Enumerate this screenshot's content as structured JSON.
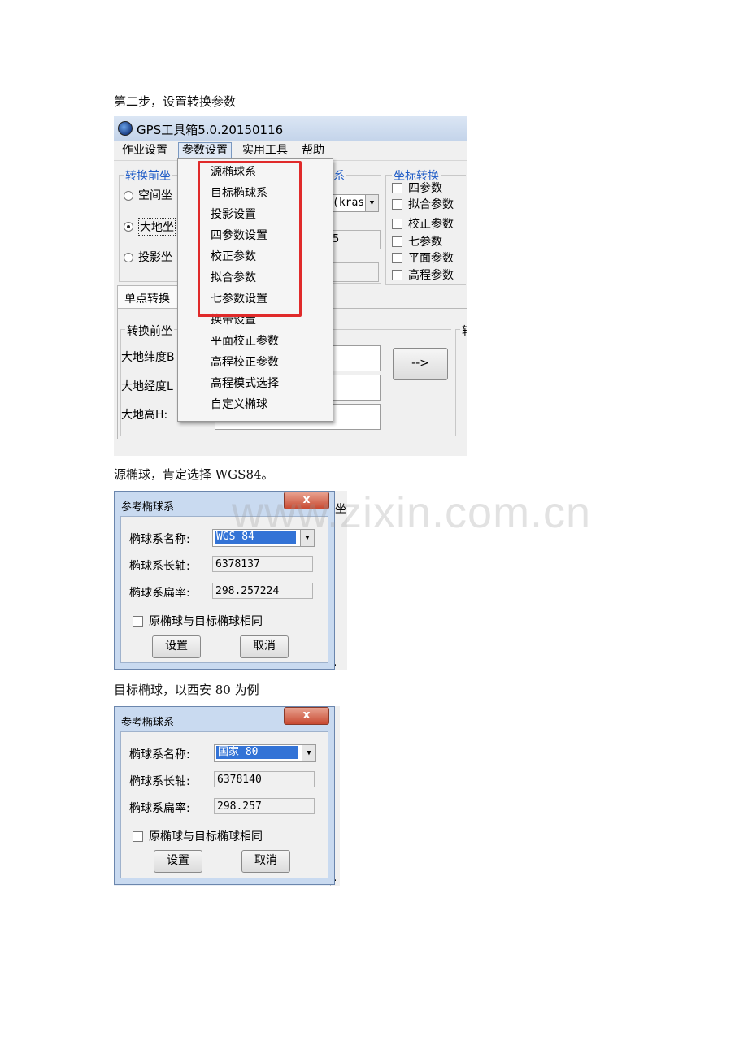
{
  "paragraphs": {
    "step2": "第二步，设置转换参数",
    "source_ellipsoid_note": "源椭球，肯定选择 WGS84。",
    "target_ellipsoid_note": "目标椭球，以西安 80 为例"
  },
  "watermark": "www.zixin.com.cn",
  "app": {
    "title": "GPS工具箱5.0.20150116",
    "menus": [
      "作业设置",
      "参数设置",
      "实用工具",
      "帮助"
    ],
    "active_menu": "参数设置",
    "left_group_label": "转换前坐",
    "radios": [
      "空间坐",
      "大地坐",
      "投影坐"
    ],
    "selected_radio": "大地坐",
    "mid_group_tail": "系",
    "combo_text": "(kras",
    "field_digit": "5",
    "right_group_label": "坐标转换",
    "checkboxes": [
      "四参数",
      "拟合参数",
      "校正参数",
      "七参数",
      "平面参数",
      "高程参数"
    ],
    "tab_label": "单点转换",
    "lower_group_label": "转换前坐",
    "lower_right_partial": "转",
    "field_labels": [
      "大地纬度B",
      "大地经度L",
      "大地高H:"
    ],
    "arrow_button": "-->",
    "dropdown_items": [
      "源椭球系",
      "目标椭球系",
      "投影设置",
      "四参数设置",
      "校正参数",
      "拟合参数",
      "七参数设置",
      "换带设置",
      "平面校正参数",
      "高程校正参数",
      "高程模式选择",
      "自定义椭球"
    ],
    "highlight_color": "#e02a2a"
  },
  "dialog1": {
    "title": "参考椭球系",
    "close": "x",
    "name_label": "椭球系名称:",
    "name_value": "WGS 84",
    "axis_label": "椭球系长轴:",
    "axis_value": "6378137",
    "flat_label": "椭球系扁率:",
    "flat_value": "298.257224",
    "same_checkbox": "原椭球与目标椭球相同",
    "ok": "设置",
    "cancel": "取消",
    "bg_fragment_1": "坐",
    "bg_fragment_2": "0."
  },
  "dialog2": {
    "title": "参考椭球系",
    "close": "x",
    "name_label": "椭球系名称:",
    "name_value": "国家 80",
    "axis_label": "椭球系长轴:",
    "axis_value": "6378140",
    "flat_label": "椭球系扁率:",
    "flat_value": "298.257",
    "same_checkbox": "原椭球与目标椭球相同",
    "ok": "设置",
    "cancel": "取消",
    "bg_fragment_1": "3."
  }
}
